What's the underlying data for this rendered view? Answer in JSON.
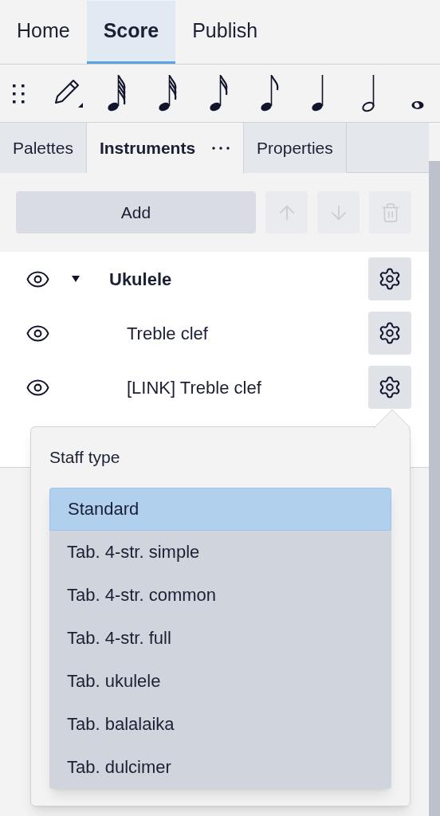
{
  "top_tabs": [
    {
      "label": "Home",
      "selected": false
    },
    {
      "label": "Score",
      "selected": true
    },
    {
      "label": "Publish",
      "selected": false
    }
  ],
  "panel_tabs": [
    {
      "label": "Palettes",
      "selected": false
    },
    {
      "label": "Instruments",
      "selected": true
    },
    {
      "label": "Properties",
      "selected": false
    }
  ],
  "buttons": [
    {
      "kind": "text",
      "label": "Add",
      "disabled": false
    },
    {
      "kind": "up",
      "disabled": true
    },
    {
      "kind": "down",
      "disabled": true
    },
    {
      "kind": "delete",
      "disabled": true
    }
  ],
  "instruments": [
    {
      "name": "Ukulele",
      "expanded": true,
      "children": [
        {
          "name": "Treble clef"
        },
        {
          "name": "[LINK] Treble clef"
        }
      ]
    }
  ],
  "popup": {
    "title": "Staff type",
    "options": [
      {
        "label": "Standard",
        "selected": true
      },
      {
        "label": "Tab. 4-str. simple",
        "selected": false
      },
      {
        "label": "Tab. 4-str. common",
        "selected": false
      },
      {
        "label": "Tab. 4-str. full",
        "selected": false
      },
      {
        "label": "Tab. ukulele",
        "selected": false
      },
      {
        "label": "Tab. balalaika",
        "selected": false
      },
      {
        "label": "Tab. dulcimer",
        "selected": false
      }
    ]
  }
}
